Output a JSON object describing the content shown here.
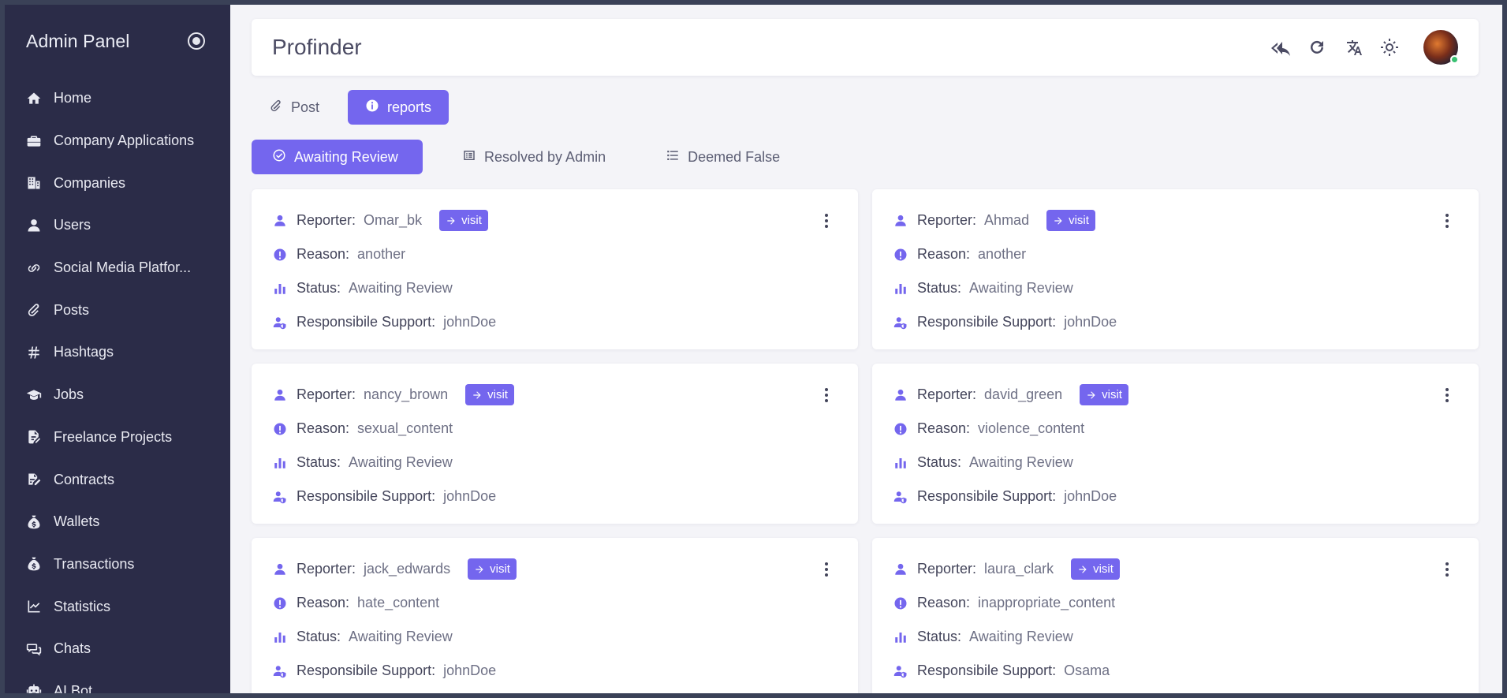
{
  "sidebar": {
    "title": "Admin Panel",
    "items": [
      {
        "label": "Home",
        "icon": "home-icon"
      },
      {
        "label": "Company Applications",
        "icon": "briefcase-icon"
      },
      {
        "label": "Companies",
        "icon": "building-icon"
      },
      {
        "label": "Users",
        "icon": "user-icon"
      },
      {
        "label": "Social Media Platfor...",
        "icon": "link-icon"
      },
      {
        "label": "Posts",
        "icon": "paperclip-icon"
      },
      {
        "label": "Hashtags",
        "icon": "hashtag-icon"
      },
      {
        "label": "Jobs",
        "icon": "graduation-cap-icon"
      },
      {
        "label": "Freelance Projects",
        "icon": "file-pen-icon"
      },
      {
        "label": "Contracts",
        "icon": "signature-icon"
      },
      {
        "label": "Wallets",
        "icon": "money-bag-icon"
      },
      {
        "label": "Transactions",
        "icon": "money-bag-icon"
      },
      {
        "label": "Statistics",
        "icon": "chart-line-icon"
      },
      {
        "label": "Chats",
        "icon": "chat-icon"
      },
      {
        "label": "AI Bot",
        "icon": "robot-icon"
      }
    ]
  },
  "header": {
    "title": "Profinder",
    "actions": [
      "reply-all-icon",
      "refresh-icon",
      "translate-icon",
      "sun-icon"
    ]
  },
  "tabs": [
    {
      "label": "Post",
      "icon": "paperclip-icon",
      "active": false
    },
    {
      "label": "reports",
      "icon": "info-icon",
      "active": true
    }
  ],
  "subtabs": [
    {
      "label": "Awaiting Review",
      "icon": "check-circle-icon",
      "active": true
    },
    {
      "label": "Resolved by Admin",
      "icon": "list-alt-icon",
      "active": false
    },
    {
      "label": "Deemed False",
      "icon": "list-check-icon",
      "active": false
    }
  ],
  "labels": {
    "reporter": "Reporter:",
    "reason": "Reason:",
    "status": "Status:",
    "support": "Responsibile Support:",
    "visit": "visit"
  },
  "reports": [
    {
      "reporter": "Omar_bk",
      "reason": "another",
      "status": "Awaiting Review",
      "support": "johnDoe"
    },
    {
      "reporter": "Ahmad",
      "reason": "another",
      "status": "Awaiting Review",
      "support": "johnDoe"
    },
    {
      "reporter": "nancy_brown",
      "reason": "sexual_content",
      "status": "Awaiting Review",
      "support": "johnDoe"
    },
    {
      "reporter": "david_green",
      "reason": "violence_content",
      "status": "Awaiting Review",
      "support": "johnDoe"
    },
    {
      "reporter": "jack_edwards",
      "reason": "hate_content",
      "status": "Awaiting Review",
      "support": "johnDoe"
    },
    {
      "reporter": "laura_clark",
      "reason": "inappropriate_content",
      "status": "Awaiting Review",
      "support": "Osama"
    }
  ],
  "colors": {
    "accent": "#7466ee",
    "sidebar_bg": "#2b2c48",
    "page_bg": "#f4f4f8"
  }
}
